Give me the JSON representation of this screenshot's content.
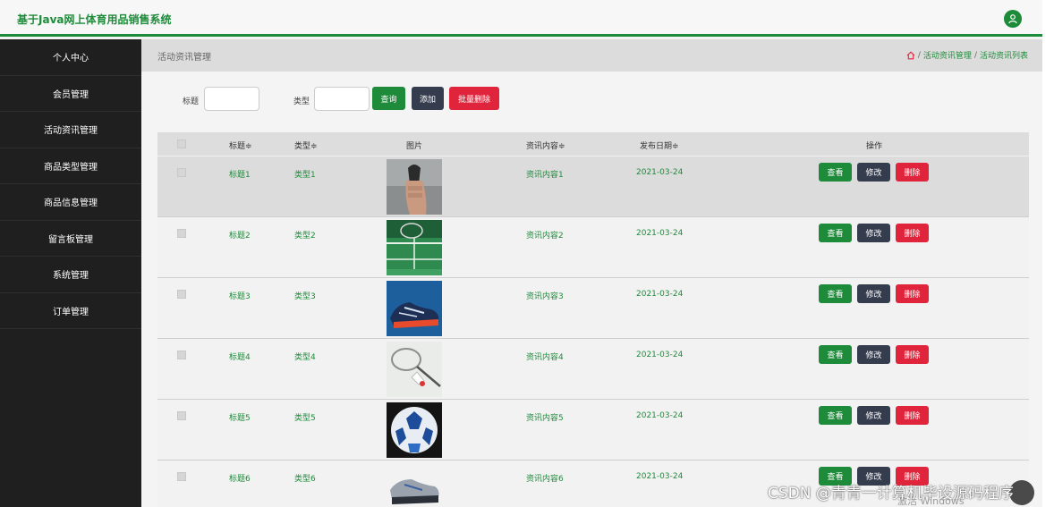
{
  "app": {
    "title": "基于Java网上体育用品销售系统"
  },
  "sidebar": {
    "items": [
      {
        "label": "个人中心"
      },
      {
        "label": "会员管理"
      },
      {
        "label": "活动资讯管理"
      },
      {
        "label": "商品类型管理"
      },
      {
        "label": "商品信息管理"
      },
      {
        "label": "留言板管理"
      },
      {
        "label": "系统管理"
      },
      {
        "label": "订单管理"
      }
    ]
  },
  "header": {
    "page_title": "活动资讯管理",
    "breadcrumb": [
      "活动资讯管理",
      "活动资讯列表"
    ],
    "breadcrumb_sep": "/"
  },
  "filters": {
    "title_label": "标题",
    "title_value": "",
    "type_label": "类型",
    "type_value": "",
    "query_label": "查询",
    "add_label": "添加",
    "batch_delete_label": "批量删除"
  },
  "table": {
    "columns": [
      "标题≑",
      "类型≑",
      "图片",
      "资讯内容≑",
      "发布日期≑",
      "操作"
    ],
    "rows": [
      {
        "title": "标题1",
        "type": "类型1",
        "image": "grip-trainer",
        "content": "资讯内容1",
        "date": "2021-03-24"
      },
      {
        "title": "标题2",
        "type": "类型2",
        "image": "badminton-court",
        "content": "资讯内容2",
        "date": "2021-03-24"
      },
      {
        "title": "标题3",
        "type": "类型3",
        "image": "blue-sneaker",
        "content": "资讯内容3",
        "date": "2021-03-24"
      },
      {
        "title": "标题4",
        "type": "类型4",
        "image": "badminton-racket",
        "content": "资讯内容4",
        "date": "2021-03-24"
      },
      {
        "title": "标题5",
        "type": "类型5",
        "image": "soccer-ball",
        "content": "资讯内容5",
        "date": "2021-03-24"
      },
      {
        "title": "标题6",
        "type": "类型6",
        "image": "running-shoe",
        "content": "资讯内容6",
        "date": "2021-03-24"
      }
    ],
    "actions": {
      "view": "查看",
      "edit": "修改",
      "delete": "删除"
    }
  },
  "overlay": {
    "watermark": "CSDN @青青一计算机毕设源码程序",
    "windows_mark": "激活 Windows"
  },
  "colors": {
    "accent": "#1e8b3a",
    "dark_button": "#353c4d",
    "danger": "#e0243b",
    "sidebar": "#1f1f1f"
  }
}
